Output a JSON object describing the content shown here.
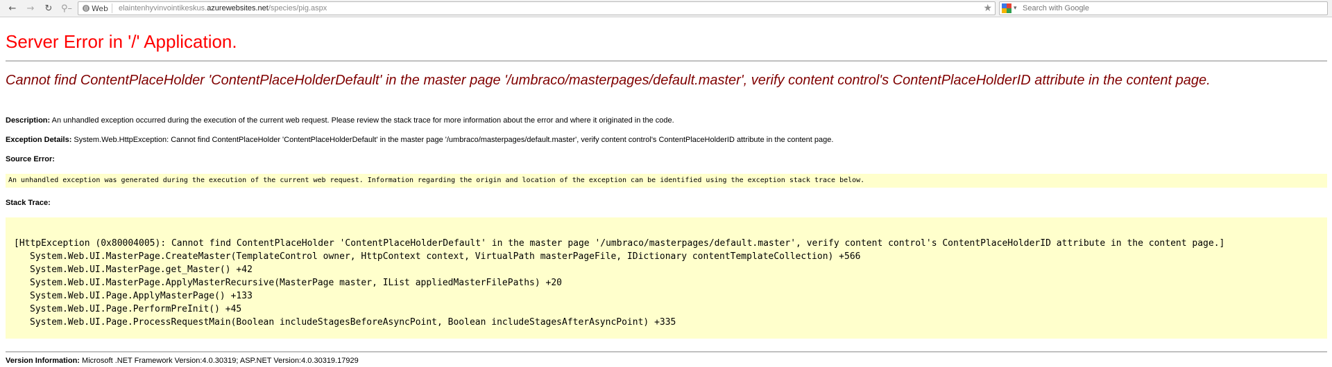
{
  "browser": {
    "nav": {
      "back_icon": "back-arrow-icon",
      "forward_icon": "forward-arrow-icon",
      "reload_icon": "reload-icon",
      "key_icon": "key-icon"
    },
    "address": {
      "site_label": "Web",
      "url_prefix": "elaintenhyvinvointikeskus.",
      "url_host": "azurewebsites.net",
      "url_path": "/species/pig.aspx"
    },
    "search": {
      "placeholder": "Search with Google"
    }
  },
  "page": {
    "title": "Server Error in '/' Application.",
    "error_heading": "Cannot find ContentPlaceHolder 'ContentPlaceHolderDefault' in the master page '/umbraco/masterpages/default.master', verify content control's ContentPlaceHolderID attribute in the content page.",
    "description_label": "Description:",
    "description_text": " An unhandled exception occurred during the execution of the current web request. Please review the stack trace for more information about the error and where it originated in the code.",
    "exception_label": "Exception Details:",
    "exception_text": " System.Web.HttpException: Cannot find ContentPlaceHolder 'ContentPlaceHolderDefault' in the master page '/umbraco/masterpages/default.master', verify content control's ContentPlaceHolderID attribute in the content page.",
    "source_error_label": "Source Error:",
    "source_error_text": "An unhandled exception was generated during the execution of the current web request. Information regarding the origin and location of the exception can be identified using the exception stack trace below.",
    "stack_trace_label": "Stack Trace:",
    "stack_trace": [
      "[HttpException (0x80004005): Cannot find ContentPlaceHolder 'ContentPlaceHolderDefault' in the master page '/umbraco/masterpages/default.master', verify content control's ContentPlaceHolderID attribute in the content page.]",
      "System.Web.UI.MasterPage.CreateMaster(TemplateControl owner, HttpContext context, VirtualPath masterPageFile, IDictionary contentTemplateCollection) +566",
      "System.Web.UI.MasterPage.get_Master() +42",
      "System.Web.UI.MasterPage.ApplyMasterRecursive(MasterPage master, IList appliedMasterFilePaths) +20",
      "System.Web.UI.Page.ApplyMasterPage() +133",
      "System.Web.UI.Page.PerformPreInit() +45",
      "System.Web.UI.Page.ProcessRequestMain(Boolean includeStagesBeforeAsyncPoint, Boolean includeStagesAfterAsyncPoint) +335"
    ],
    "version_label": "Version Information:",
    "version_text": " Microsoft .NET Framework Version:4.0.30319; ASP.NET Version:4.0.30319.17929"
  },
  "colors": {
    "title": "#ff0000",
    "error_heading": "#800000",
    "code_background": "#ffffcc",
    "rule": "#c0c0c0"
  }
}
